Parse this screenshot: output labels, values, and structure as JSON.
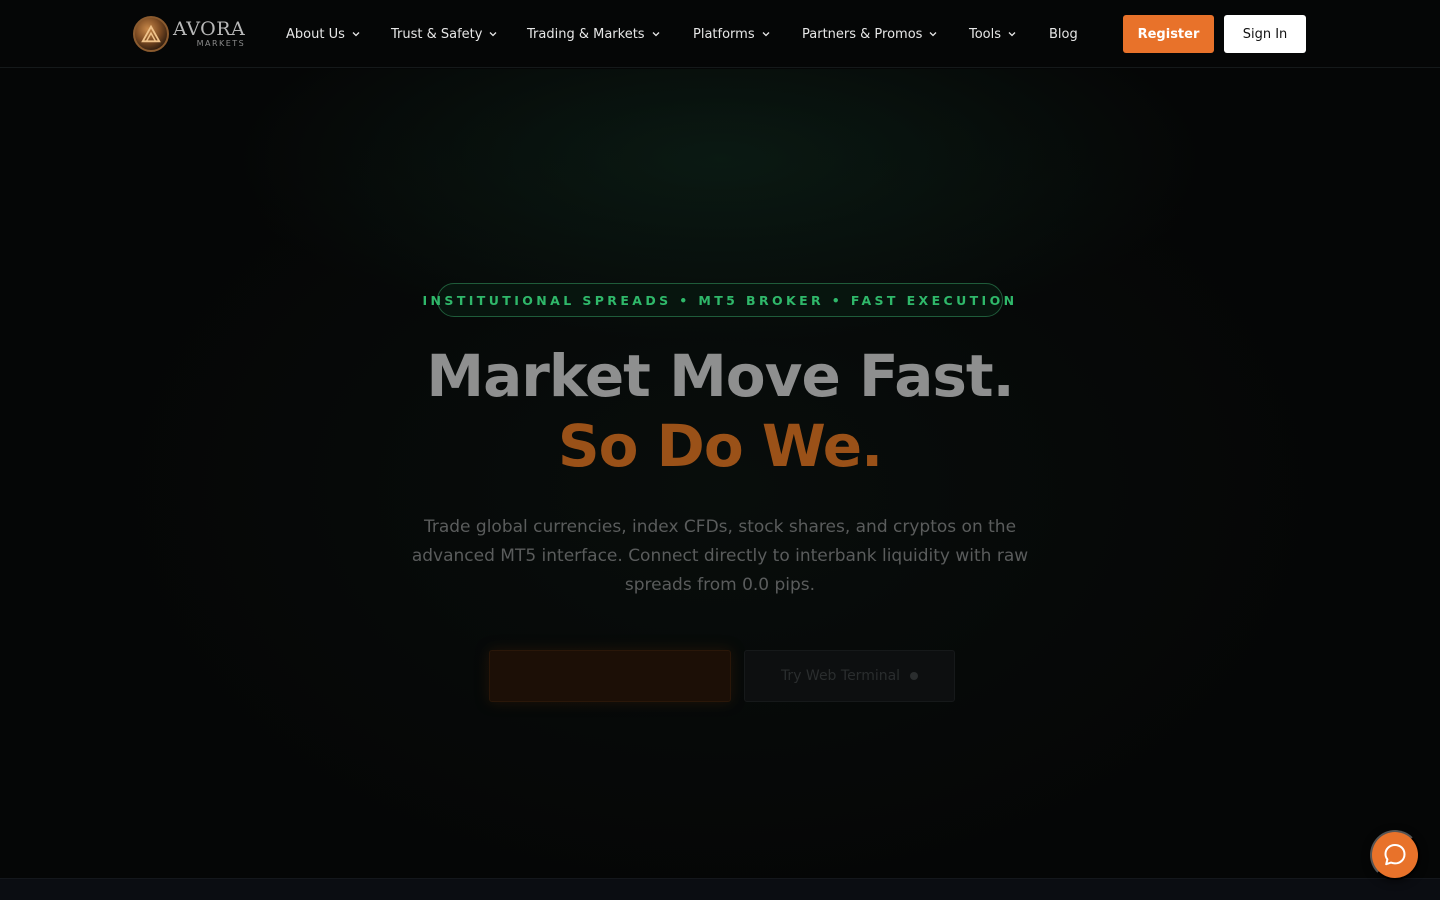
{
  "brand": {
    "name": "AVORA",
    "sub": "MARKETS",
    "icon": "avora-logo-icon",
    "accent": "#e8722a"
  },
  "nav": {
    "items": [
      {
        "label": "About Us",
        "dropdown": true
      },
      {
        "label": "Trust & Safety",
        "dropdown": true
      },
      {
        "label": "Trading & Markets",
        "dropdown": true
      },
      {
        "label": "Platforms",
        "dropdown": true
      },
      {
        "label": "Partners & Promos",
        "dropdown": true
      },
      {
        "label": "Tools",
        "dropdown": true
      },
      {
        "label": "Blog",
        "dropdown": false
      }
    ],
    "register_label": "Register",
    "signin_label": "Sign In"
  },
  "hero": {
    "tagline": "INSTITUTIONAL SPREADS • MT5 BROKER • FAST EXECUTION",
    "headline_line1": "Market Move Fast.",
    "headline_line2": "So Do We.",
    "subtext": "Trade global currencies, index CFDs, stock shares, and cryptos on the advanced MT5 interface. Connect directly to interbank liquidity with raw spreads from 0.0 pips.",
    "cta_primary_label": "",
    "cta_secondary_label": "Try Web Terminal"
  },
  "chat": {
    "icon": "chat-bubble-icon",
    "color": "#e8722a"
  }
}
